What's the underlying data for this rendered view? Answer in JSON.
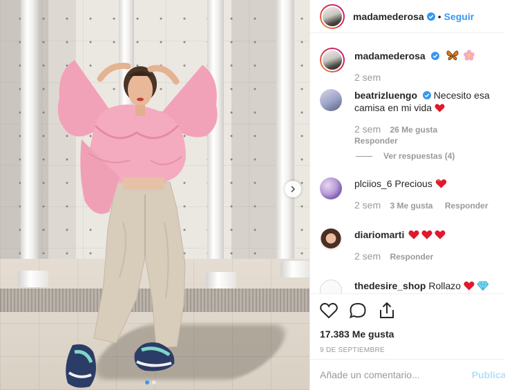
{
  "post": {
    "author": "madamederosa",
    "follow_label": "Seguir",
    "separator": "•",
    "caption_time": "2 sem",
    "likes_text": "17.383 Me gusta",
    "date": "9 DE SEPTIEMBRE",
    "comment_placeholder": "Añade un comentario...",
    "publish_label": "Publicar"
  },
  "comments": [
    {
      "user": "beatrizluengo",
      "verified": true,
      "text": "Necesito esa camisa en mi vida",
      "time": "2 sem",
      "likes": "26 Me gusta",
      "reply_label": "Responder",
      "view_replies": "Ver respuestas (4)"
    },
    {
      "user": "plciios_6",
      "text": "Precious",
      "time": "2 sem",
      "likes": "3 Me gusta",
      "reply_label": "Responder"
    },
    {
      "user": "diariomarti",
      "text": "",
      "time": "2 sem",
      "reply_label": "Responder"
    },
    {
      "user": "thedesire_shop",
      "text": "Rollazo"
    }
  ],
  "icons": [
    "heart-icon",
    "comment-icon",
    "share-icon",
    "verified-icon",
    "butterfly-emoji",
    "flower-emoji",
    "red-heart-emoji",
    "diamond-emoji",
    "next-arrow-icon"
  ],
  "colors": {
    "link_blue": "#3897f0",
    "meta_gray": "#999999",
    "text": "#262626",
    "heart_red": "#ed4956"
  }
}
